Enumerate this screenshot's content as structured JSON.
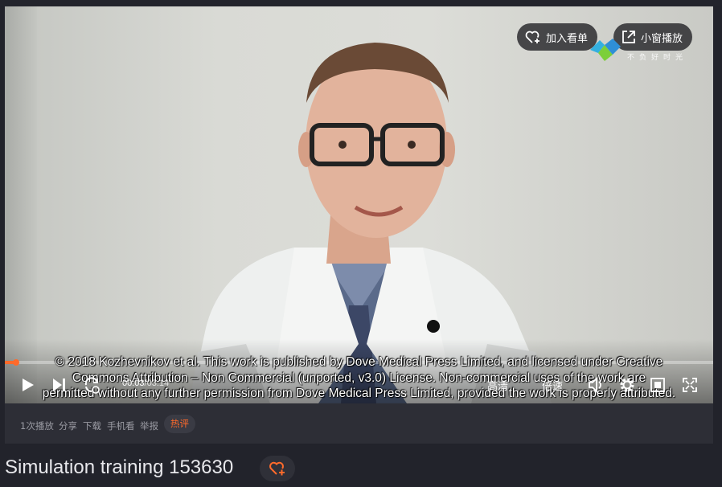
{
  "player": {
    "add_to_list_label": "加入看单",
    "mini_player_label": "小窗播放",
    "watermark_text": "不负好时光",
    "current_time": "00:03",
    "total_time": "/03:14",
    "progress_fraction": 0.003,
    "quality_label": "高清",
    "speed_label": "倍速",
    "subtitle_text": "© 2018 Kozhevnikov et al. This work is published by Dove Medical Press Limited, and licensed under Creative\nCommons Attribution – Non Commercial (unported, v3.0) License. Non-commercial uses of the work are\npermitted without any further permission from Dove Medical Press Limited, provided the work is properly attributed.",
    "accent_color": "#ff6a2b"
  },
  "info_bar": {
    "plays": "1次播放",
    "share": "分享",
    "download": "下载",
    "mobile": "手机看",
    "report": "举报",
    "hot_comments": "热评"
  },
  "video": {
    "title": "Simulation training 153630"
  },
  "icons": [
    "heart-plus-icon",
    "external-link-icon",
    "play-icon",
    "next-icon",
    "loop-icon",
    "volume-icon",
    "settings-icon",
    "picture-in-picture-icon",
    "fullscreen-icon"
  ]
}
